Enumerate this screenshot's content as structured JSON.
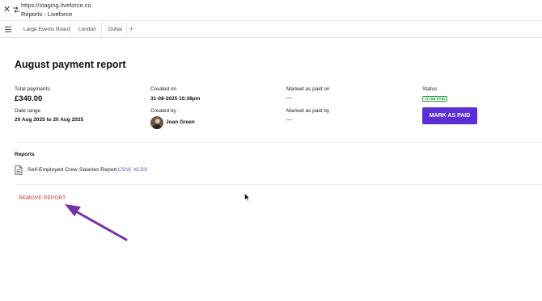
{
  "browser": {
    "url": "https://staging.liveforce.co",
    "page_title": "Reports - Liveforce"
  },
  "tabs": [
    {
      "label": "Large Events Board"
    },
    {
      "label": "London"
    },
    {
      "label": "Dubai"
    }
  ],
  "tab_add": "+",
  "report": {
    "title": "August payment report",
    "total_payments_label": "Total payments",
    "total_payments_value": "£340.00",
    "created_on_label": "Created on",
    "created_on_value": "31-08-2025 10:38pm",
    "marked_paid_on_label": "Marked as paid on",
    "marked_paid_on_value": "—",
    "status_label": "Status",
    "status_value": "TO BE PAID",
    "date_range_label": "Date range",
    "date_range_value": "20 Aug 2025 to 20 Aug 2025",
    "created_by_label": "Created by",
    "created_by_value": "Joan Green",
    "marked_paid_by_label": "Marked as paid by",
    "marked_paid_by_value": "—",
    "mark_paid_button": "MARK AS PAID"
  },
  "reports_section": {
    "title": "Reports",
    "items": [
      {
        "name": "Self-Employed Crew Salaries Report",
        "csv": "CSV",
        "separator": "|",
        "xlsx": "XLSX"
      }
    ]
  },
  "remove_report": "REMOVE REPORT",
  "colors": {
    "accent": "#5b2fd4",
    "danger": "#d22a2a",
    "status_green": "#2e9e3f",
    "annotation_arrow": "#7b2fa8"
  }
}
